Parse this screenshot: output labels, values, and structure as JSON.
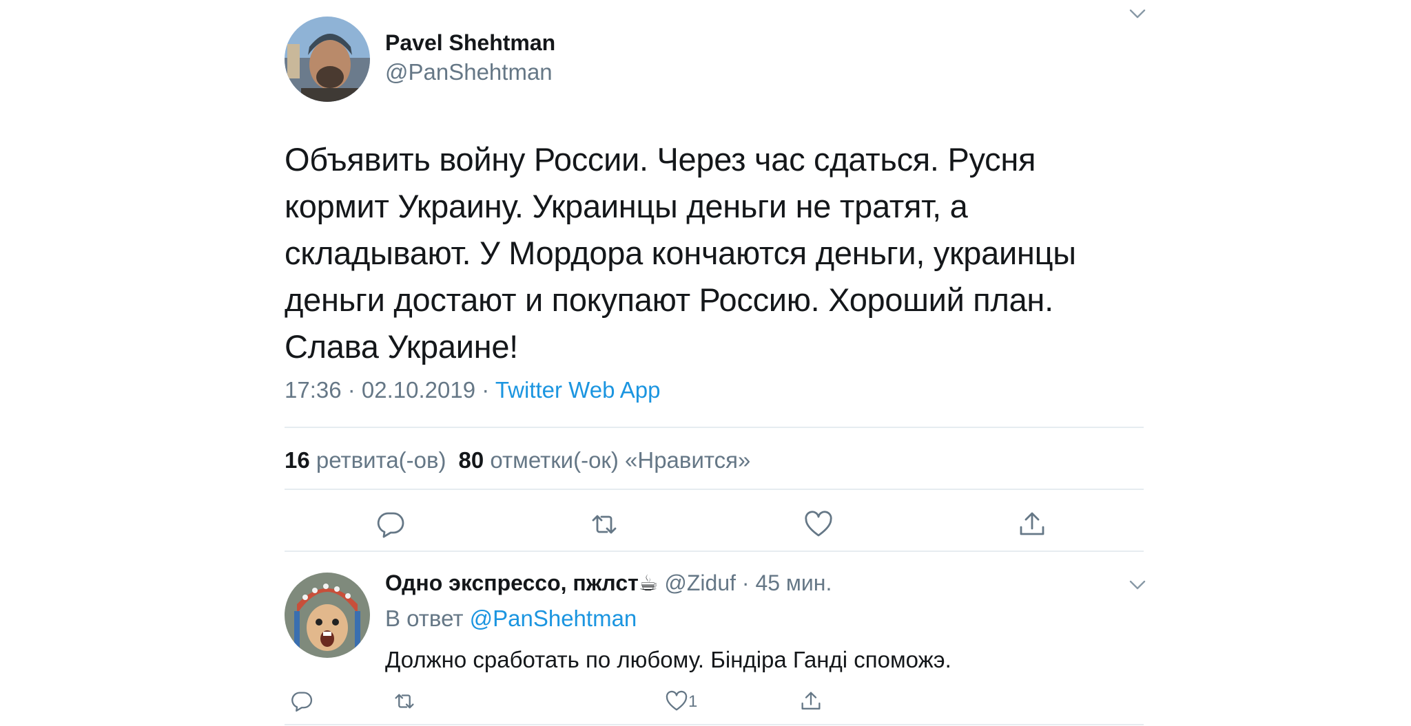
{
  "tweet": {
    "author_name": "Pavel Shehtman",
    "author_handle": "@PanShehtman",
    "text": "Объявить войну России. Через час сдаться. Русня кормит Украину. Украинцы деньги не тратят, а складывают. У Мордора кончаются деньги, украинцы деньги достают и покупают Россию. Хороший план. Слава Украине!",
    "timestamp": "17:36 · 02.10.2019 · ",
    "source": "Twitter Web App",
    "retweets_count": "16",
    "retweets_label": "ретвита(-ов)",
    "likes_count": "80",
    "likes_label": "отметки(-ок) «Нравится»",
    "menu_icon": "chevron-down-icon",
    "actions": [
      "reply-icon",
      "retweet-icon",
      "like-icon",
      "share-icon"
    ]
  },
  "reply": {
    "author_name": "Одно экспрессо, пжлст☕",
    "meta": " @Ziduf · 45 мин.",
    "reply_prefix": "В ответ ",
    "reply_mention": "@PanShehtman",
    "text": "Должно сработать по любому. Біндіра Ганді споможэ.",
    "like_count": "1"
  },
  "colors": {
    "accent": "#1b95e0",
    "secondary_text": "#657786",
    "divider": "#e6ecf0",
    "primary_text": "#14171a"
  }
}
